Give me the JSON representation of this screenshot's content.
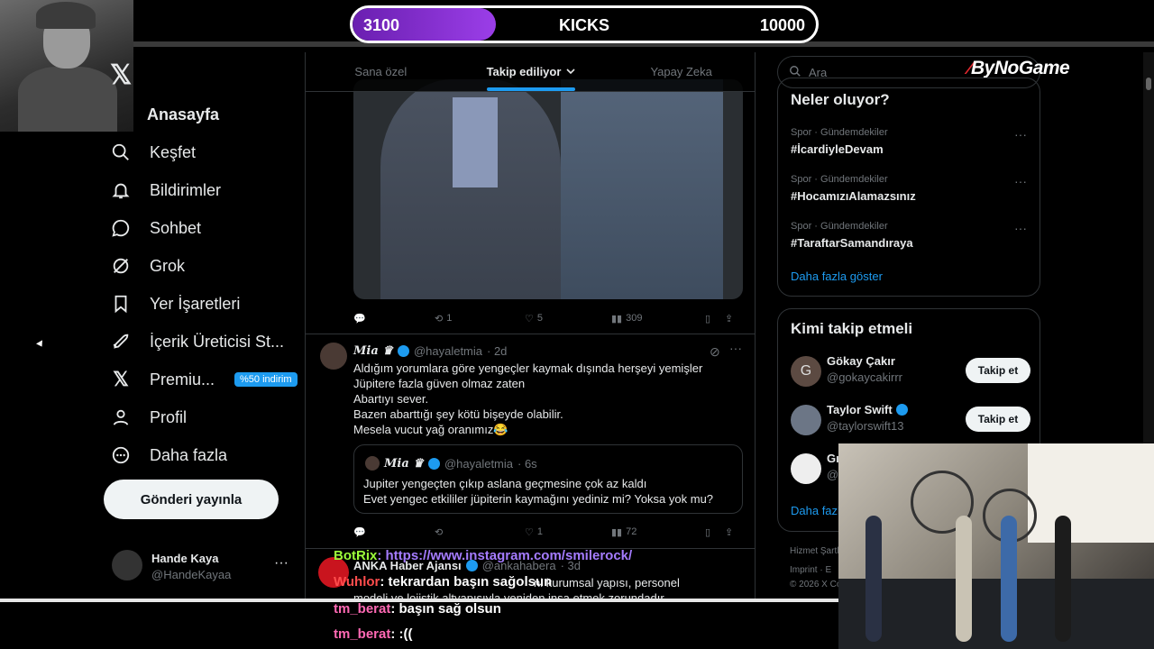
{
  "kicks": {
    "current": "3100",
    "label": "KICKS",
    "goal": "10000",
    "progress_fraction": 0.31
  },
  "nav": {
    "home": "Anasayfa",
    "items": [
      {
        "label": "Keşfet",
        "icon": "search-icon"
      },
      {
        "label": "Bildirimler",
        "icon": "bell-icon"
      },
      {
        "label": "Sohbet",
        "icon": "chat-icon"
      },
      {
        "label": "Grok",
        "icon": "grok-icon"
      },
      {
        "label": "Yer İşaretleri",
        "icon": "bookmark-icon"
      },
      {
        "label": "İçerik Üreticisi St...",
        "icon": "rocket-icon"
      },
      {
        "label": "Premiu...",
        "icon": "x-logo-icon",
        "badge": "%50 indirim"
      },
      {
        "label": "Profil",
        "icon": "person-icon"
      },
      {
        "label": "Daha fazla",
        "icon": "more-circle-icon"
      }
    ],
    "post_button": "Gönderi yayınla",
    "account": {
      "name": "Hande Kaya",
      "handle": "@HandeKayaa"
    }
  },
  "tabs": [
    "Sana özel",
    "Takip ediliyor",
    "Yapay Zeka"
  ],
  "tweet1": {
    "replies": "",
    "retweets": "1",
    "likes": "5",
    "views": "309"
  },
  "tweet2": {
    "name": "Mia ♛",
    "handle": "@hayaletmia",
    "time": "· 2d",
    "lines": [
      "Aldığım yorumlara göre yengeçler kaymak dışında herşeyi yemişler",
      "Jüpitere fazla güven olmaz zaten",
      "Abartıyı sever.",
      "Bazen abarttığı şey kötü bişeyde olabilir.",
      "Mesela vucut yağ oranımız😂"
    ],
    "quote": {
      "name": "Mia ♛",
      "handle": "@hayaletmia",
      "time": "· 6s",
      "lines": [
        "Jupiter yengeçten çıkıp aslana geçmesine çok az kaldı",
        "Evet yengec etkililer jüpiterin kaymağını yediniz mi? Yoksa yok mu?"
      ]
    },
    "replies": "",
    "retweets": "",
    "likes": "1",
    "views": "72"
  },
  "tweet3": {
    "name": "ANKA Haber Ajansı",
    "handle": "@ankahabera",
    "time": "· 3d",
    "line1": "ni kurumsal yapısı, personel",
    "line2": "modeli ve lojistik altyapısıyla yeniden inşa etmek zorundadır"
  },
  "search": {
    "placeholder": "Ara"
  },
  "brand": "ByNoGame",
  "trends": {
    "title": "Neler oluyor?",
    "items": [
      {
        "category": "Spor · Gündemdekiler",
        "tag": "#İcardiyleDevam"
      },
      {
        "category": "Spor · Gündemdekiler",
        "tag": "#HocamızıAlamazsınız"
      },
      {
        "category": "Spor · Gündemdekiler",
        "tag": "#TaraftarSamandıraya"
      }
    ],
    "more": "Daha fazla göster"
  },
  "who_to_follow": {
    "title": "Kimi takip etmeli",
    "items": [
      {
        "name": "Gökay Çakır",
        "handle": "@gokaycakirrr",
        "initial": "G",
        "verified": false
      },
      {
        "name": "Taylor Swift",
        "handle": "@taylorswift13",
        "initial": "",
        "verified": true
      },
      {
        "name": "Gı",
        "handle": "@g",
        "initial": "",
        "verified": false
      }
    ],
    "follow_label": "Takip et",
    "more": "Daha fazl"
  },
  "footer": {
    "line1": "Hizmet Şartl",
    "line2": "Imprint · E",
    "line3": "© 2026 X Co"
  },
  "chat": [
    {
      "user": "BotRix",
      "message": ": https://www.instagram.com/smilerock/",
      "kind": "bot"
    },
    {
      "user": "Wuhlor",
      "message": ": tekrardan başın sağolsun",
      "kind": "user"
    },
    {
      "user": "tm_berat",
      "message": ": başın sağ olsun",
      "kind": "user"
    },
    {
      "user": "tm_berat",
      "message": ": :((",
      "kind": "user"
    }
  ],
  "colors": {
    "accent": "#1d9bf0",
    "kicks_fill": "#8a2be2",
    "brand_red": "#e0282e"
  }
}
